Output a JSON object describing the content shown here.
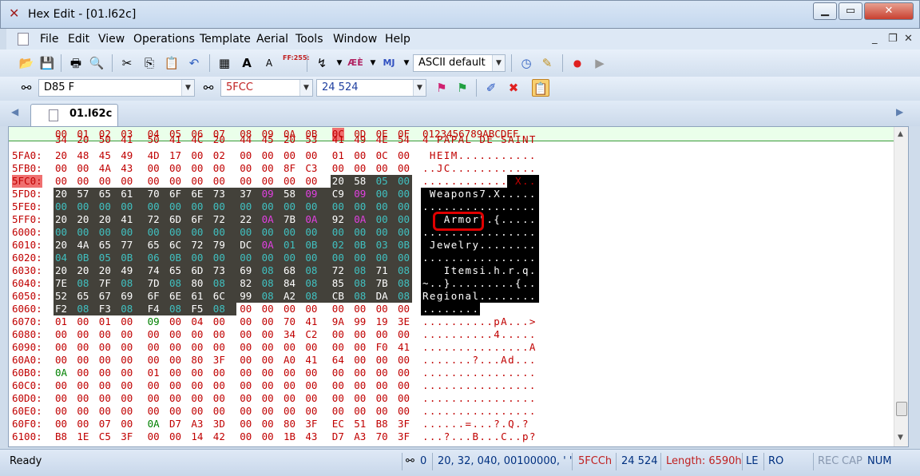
{
  "window": {
    "title": "Hex Edit - [01.l62c]"
  },
  "menu": [
    "File",
    "Edit",
    "View",
    "Operations",
    "Template",
    "Aerial",
    "Tools",
    "Window",
    "Help"
  ],
  "toolbar": {
    "charset": "ASCII default",
    "ascii_icon_text": "FF:255:",
    "mj_icon_text": "MJ"
  },
  "toolbar2": {
    "search_text": "D85 F",
    "hex_address": "5FCC",
    "dec_address": "24 524"
  },
  "tab": {
    "label": "01.l62c"
  },
  "header": {
    "hex_cols": [
      "00",
      "01",
      "02",
      "03",
      "04",
      "05",
      "06",
      "07",
      "08",
      "09",
      "0A",
      "0B",
      "0C",
      "0D",
      "0E",
      "0F"
    ],
    "ascii_label": "0123456789ABCDEF",
    "active_col": "0C",
    "active_ascii": "C"
  },
  "rows": [
    {
      "addr": "",
      "hex": [
        "34",
        "20",
        "50",
        "41",
        "50",
        "41",
        "4C",
        "20",
        "44",
        "45",
        "20",
        "53",
        "41",
        "49",
        "4E",
        "54"
      ],
      "ascii": "4 PAPAL DE SAINT"
    },
    {
      "addr": "5FA0:",
      "hex": [
        "20",
        "48",
        "45",
        "49",
        "4D",
        "17",
        "00",
        "02",
        "00",
        "00",
        "00",
        "00",
        "01",
        "00",
        "0C",
        "00"
      ],
      "ascii": " HEIM..........."
    },
    {
      "addr": "5FB0:",
      "hex": [
        "00",
        "00",
        "4A",
        "43",
        "00",
        "00",
        "00",
        "00",
        "00",
        "00",
        "8F",
        "C3",
        "00",
        "00",
        "00",
        "00"
      ],
      "ascii": "..JC............"
    },
    {
      "addr": "5FC0:",
      "hex": [
        "00",
        "00",
        "00",
        "00",
        "00",
        "00",
        "00",
        "00",
        "00",
        "00",
        "00",
        "00",
        "20",
        "58",
        "05",
        "00"
      ],
      "ascii": "............ X.."
    },
    {
      "addr": "5FD0:",
      "hex": [
        "20",
        "57",
        "65",
        "61",
        "70",
        "6F",
        "6E",
        "73",
        "37",
        "09",
        "58",
        "09",
        "C9",
        "09",
        "00",
        "00"
      ],
      "ascii": " Weapons7.X....."
    },
    {
      "addr": "5FE0:",
      "hex": [
        "00",
        "00",
        "00",
        "00",
        "00",
        "00",
        "00",
        "00",
        "00",
        "00",
        "00",
        "00",
        "00",
        "00",
        "00",
        "00"
      ],
      "ascii": "................"
    },
    {
      "addr": "5FF0:",
      "hex": [
        "20",
        "20",
        "20",
        "41",
        "72",
        "6D",
        "6F",
        "72",
        "22",
        "0A",
        "7B",
        "0A",
        "92",
        "0A",
        "00",
        "00"
      ],
      "ascii": "   Armor\".{....."
    },
    {
      "addr": "6000:",
      "hex": [
        "00",
        "00",
        "00",
        "00",
        "00",
        "00",
        "00",
        "00",
        "00",
        "00",
        "00",
        "00",
        "00",
        "00",
        "00",
        "00"
      ],
      "ascii": "................"
    },
    {
      "addr": "6010:",
      "hex": [
        "20",
        "4A",
        "65",
        "77",
        "65",
        "6C",
        "72",
        "79",
        "DC",
        "0A",
        "01",
        "0B",
        "02",
        "0B",
        "03",
        "0B"
      ],
      "ascii": " Jewelry........"
    },
    {
      "addr": "6020:",
      "hex": [
        "04",
        "0B",
        "05",
        "0B",
        "06",
        "0B",
        "00",
        "00",
        "00",
        "00",
        "00",
        "00",
        "00",
        "00",
        "00",
        "00"
      ],
      "ascii": "................"
    },
    {
      "addr": "6030:",
      "hex": [
        "20",
        "20",
        "20",
        "49",
        "74",
        "65",
        "6D",
        "73",
        "69",
        "08",
        "68",
        "08",
        "72",
        "08",
        "71",
        "08"
      ],
      "ascii": "   Itemsi.h.r.q."
    },
    {
      "addr": "6040:",
      "hex": [
        "7E",
        "08",
        "7F",
        "08",
        "7D",
        "08",
        "80",
        "08",
        "82",
        "08",
        "84",
        "08",
        "85",
        "08",
        "7B",
        "08"
      ],
      "ascii": "~..}.........{.."
    },
    {
      "addr": "6050:",
      "hex": [
        "52",
        "65",
        "67",
        "69",
        "6F",
        "6E",
        "61",
        "6C",
        "99",
        "08",
        "A2",
        "08",
        "CB",
        "08",
        "DA",
        "08"
      ],
      "ascii": "Regional........"
    },
    {
      "addr": "6060:",
      "hex": [
        "F2",
        "08",
        "F3",
        "08",
        "F4",
        "08",
        "F5",
        "08",
        "00",
        "00",
        "00",
        "00",
        "00",
        "00",
        "00",
        "00"
      ],
      "ascii": "................"
    },
    {
      "addr": "6070:",
      "hex": [
        "01",
        "00",
        "01",
        "00",
        "09",
        "00",
        "04",
        "00",
        "00",
        "00",
        "70",
        "41",
        "9A",
        "99",
        "19",
        "3E"
      ],
      "ascii": "..........pA...>"
    },
    {
      "addr": "6080:",
      "hex": [
        "00",
        "00",
        "00",
        "00",
        "00",
        "00",
        "00",
        "00",
        "00",
        "00",
        "34",
        "C2",
        "00",
        "00",
        "00",
        "00"
      ],
      "ascii": "..........4....."
    },
    {
      "addr": "6090:",
      "hex": [
        "00",
        "00",
        "00",
        "00",
        "00",
        "00",
        "00",
        "00",
        "00",
        "00",
        "00",
        "00",
        "00",
        "00",
        "F0",
        "41"
      ],
      "ascii": "...............A"
    },
    {
      "addr": "60A0:",
      "hex": [
        "00",
        "00",
        "00",
        "00",
        "00",
        "00",
        "80",
        "3F",
        "00",
        "00",
        "A0",
        "41",
        "64",
        "00",
        "00",
        "00"
      ],
      "ascii": ".......?...Ad..."
    },
    {
      "addr": "60B0:",
      "hex": [
        "0A",
        "00",
        "00",
        "00",
        "01",
        "00",
        "00",
        "00",
        "00",
        "00",
        "00",
        "00",
        "00",
        "00",
        "00",
        "00"
      ],
      "ascii": "................"
    },
    {
      "addr": "60C0:",
      "hex": [
        "00",
        "00",
        "00",
        "00",
        "00",
        "00",
        "00",
        "00",
        "00",
        "00",
        "00",
        "00",
        "00",
        "00",
        "00",
        "00"
      ],
      "ascii": "................"
    },
    {
      "addr": "60D0:",
      "hex": [
        "00",
        "00",
        "00",
        "00",
        "00",
        "00",
        "00",
        "00",
        "00",
        "00",
        "00",
        "00",
        "00",
        "00",
        "00",
        "00"
      ],
      "ascii": "................"
    },
    {
      "addr": "60E0:",
      "hex": [
        "00",
        "00",
        "00",
        "00",
        "00",
        "00",
        "00",
        "00",
        "00",
        "00",
        "00",
        "00",
        "00",
        "00",
        "00",
        "00"
      ],
      "ascii": "................"
    },
    {
      "addr": "60F0:",
      "hex": [
        "00",
        "00",
        "07",
        "00",
        "0A",
        "D7",
        "A3",
        "3D",
        "00",
        "00",
        "80",
        "3F",
        "EC",
        "51",
        "B8",
        "3F"
      ],
      "ascii": "......=...?.Q.?"
    },
    {
      "addr": "6100:",
      "hex": [
        "B8",
        "1E",
        "C5",
        "3F",
        "00",
        "00",
        "14",
        "42",
        "00",
        "00",
        "1B",
        "43",
        "D7",
        "A3",
        "70",
        "3F"
      ],
      "ascii": "...?...B...C..p?"
    }
  ],
  "status": {
    "ready": "Ready",
    "count_icon": "binoculars-icon",
    "count": "0",
    "values": "20, 32, 040, 00100000, ' '",
    "hex_pos": "5FCCh",
    "dec_pos": "24 524",
    "length": "Length: 6590h",
    "endian": "LE",
    "mode": "RO",
    "rec": "REC",
    "cap": "CAP",
    "num": "NUM"
  },
  "colors": {
    "selection_bg": "#43413a",
    "ascii_sel_bg": "#000000",
    "addr_red": "#c00000",
    "hex_red": "#c00000",
    "hex_cyan": "#40c0c0",
    "hex_magenta": "#e040e0",
    "annotation": "#e00000"
  }
}
